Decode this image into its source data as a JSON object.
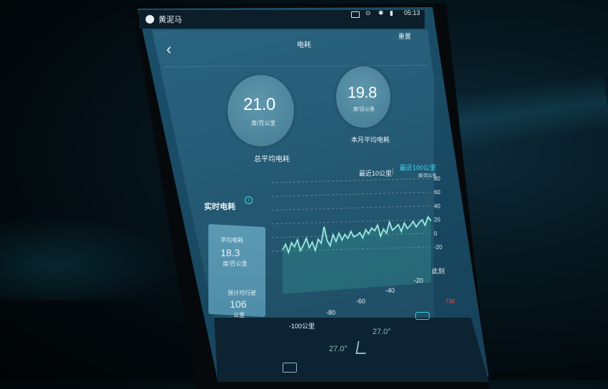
{
  "statusbar": {
    "title": "黄泥马",
    "time": "05:13"
  },
  "header": {
    "title": "电耗",
    "reset_label": "重置"
  },
  "stats": [
    {
      "value": "21.0",
      "unit": "度/百公里",
      "label": "总平均电耗"
    },
    {
      "value": "19.8",
      "unit": "度/百公里",
      "label": "本月平均电耗"
    }
  ],
  "range_tabs": [
    {
      "label": "最近10公里",
      "selected": false
    },
    {
      "label": "最近100公里",
      "selected": true
    }
  ],
  "realtime": {
    "title": "实时电耗",
    "avg_label": "平均电耗",
    "avg_value": "18.3",
    "avg_unit": "度/百公里",
    "range_label": "预计可行驶",
    "range_value": "106",
    "range_unit": "公里"
  },
  "chart_data": {
    "type": "line",
    "ylabel": "度/百公里",
    "ylim": [
      -20,
      80
    ],
    "yticks": [
      "80",
      "60",
      "40",
      "20",
      "0",
      "-20"
    ],
    "xticks": [
      "-100公里",
      "-80",
      "-60",
      "-40",
      "-20",
      "此刻"
    ],
    "xlim": [
      -100,
      0
    ],
    "series": [
      {
        "x": [
          -100,
          -98,
          -96,
          -94,
          -92,
          -90,
          -88,
          -86,
          -84,
          -82,
          -80,
          -78,
          -76,
          -74,
          -72,
          -70,
          -68,
          -66,
          -64,
          -62,
          -60,
          -58,
          -56,
          -54,
          -52,
          -50,
          -48,
          -46,
          -44,
          -42,
          -40,
          -38,
          -36,
          -34,
          -32,
          -30,
          -28,
          -26,
          -24,
          -22,
          -20,
          -18,
          -16,
          -14,
          -12,
          -10,
          -8,
          -6,
          -4,
          -2,
          0
        ],
        "y": [
          -18,
          -10,
          -22,
          -8,
          -14,
          -4,
          -20,
          -12,
          -2,
          -16,
          -8,
          -20,
          -4,
          -10,
          14,
          -6,
          -14,
          2,
          -8,
          4,
          -6,
          2,
          -4,
          6,
          -2,
          0,
          4,
          -4,
          8,
          2,
          10,
          6,
          14,
          -2,
          8,
          2,
          18,
          6,
          10,
          14,
          4,
          16,
          8,
          12,
          18,
          10,
          16,
          20,
          12,
          24,
          18
        ]
      }
    ],
    "grid": true,
    "colors": {
      "line": "#e6fbff",
      "fill": "#3fbfae"
    }
  },
  "climate": {
    "left_temp": "27.0°",
    "right_temp": "27.0°"
  },
  "car_range": "730",
  "accent": "#36d0e0"
}
